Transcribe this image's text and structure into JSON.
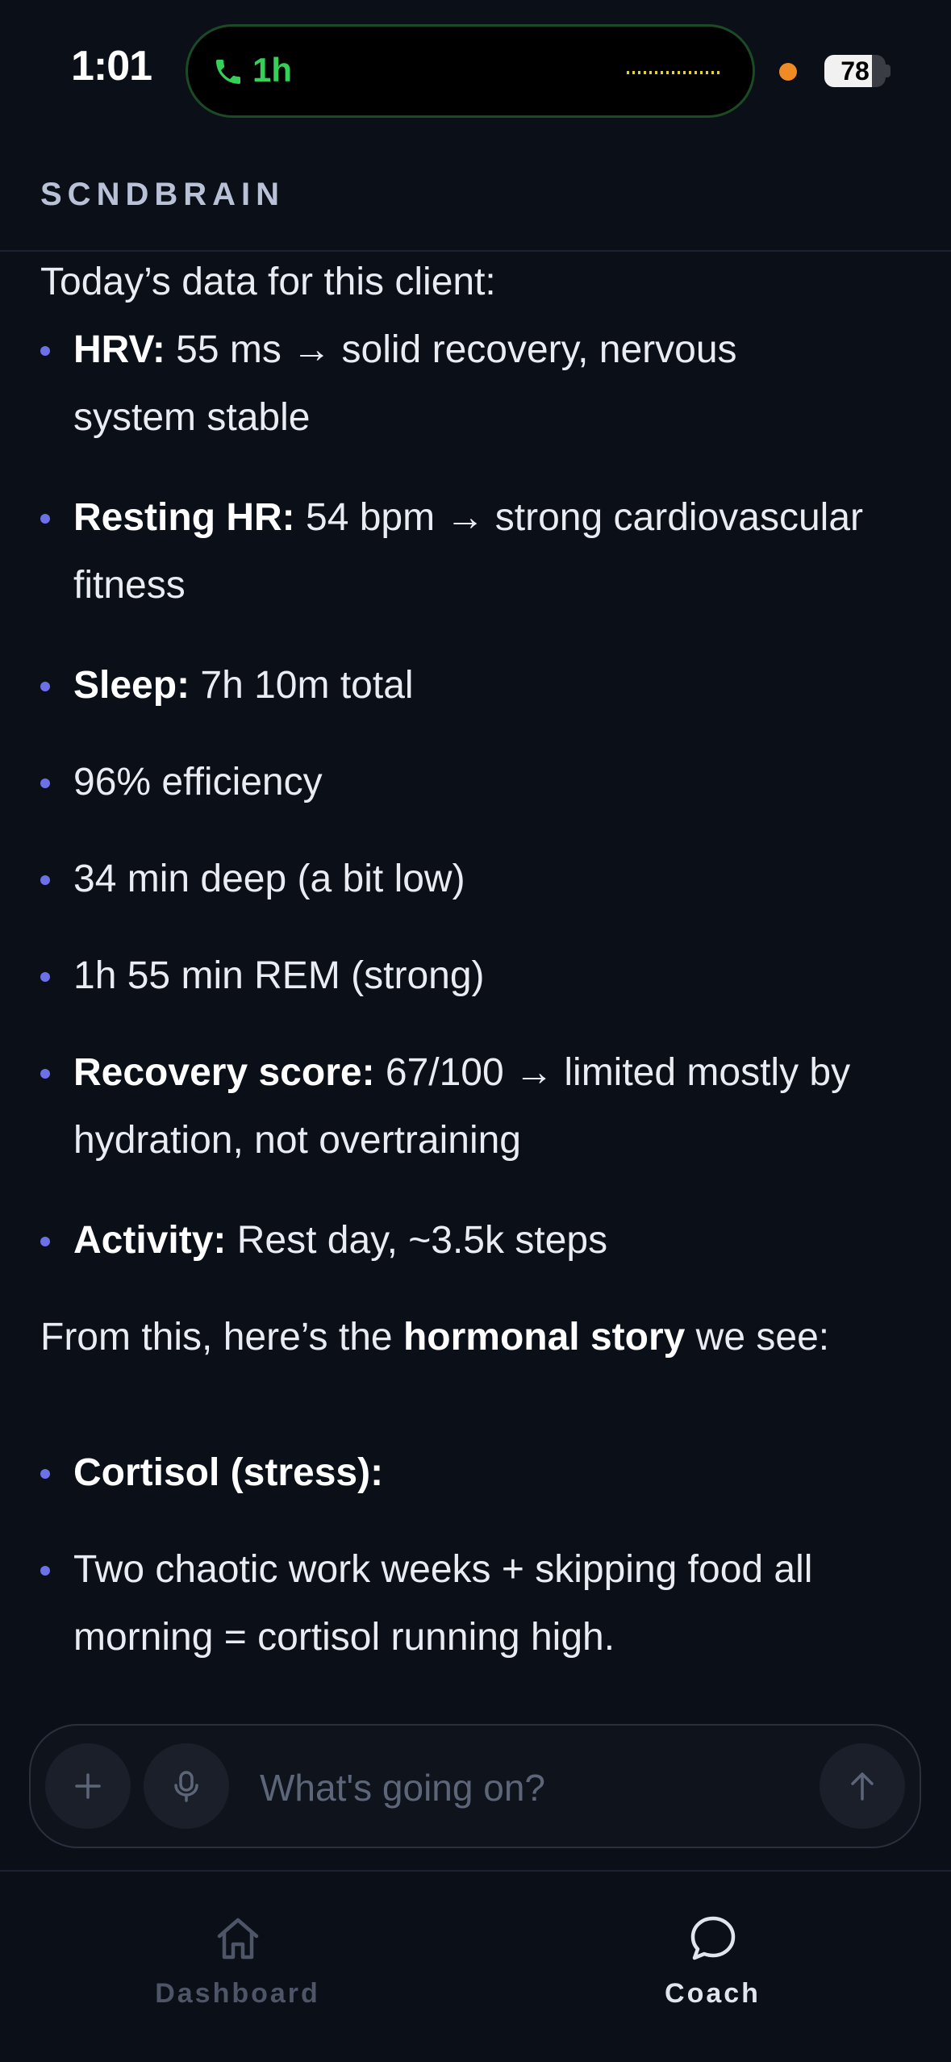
{
  "status_bar": {
    "time": "1:01",
    "call_duration": "1h",
    "battery_percent": 78,
    "battery_label": "78"
  },
  "app": {
    "brand": "SCNDBRAIN"
  },
  "chat": {
    "intro": "Today’s data for this client:",
    "metrics": [
      {
        "label": "HRV:",
        "text": " 55 ms → solid recovery, nervous system stable"
      },
      {
        "label": "Resting HR:",
        "text": " 54 bpm → strong cardiovascular fitness"
      },
      {
        "label": "Sleep:",
        "text": " 7h 10m total"
      },
      {
        "label": "",
        "text": "96% efficiency"
      },
      {
        "label": "",
        "text": "34 min deep (a bit low)"
      },
      {
        "label": "",
        "text": "1h 55 min REM (strong)"
      },
      {
        "label": "Recovery score:",
        "text": " 67/100 → limited mostly by hydration, not overtraining"
      },
      {
        "label": "Activity:",
        "text": " Rest day, ~3.5k steps"
      }
    ],
    "story_prefix": "From this, here’s the ",
    "story_bold": "hormonal story",
    "story_suffix": " we see:",
    "hormones": [
      {
        "label": "Cortisol (stress):",
        "text": ""
      },
      {
        "label": "",
        "text": "Two chaotic work weeks + skipping food all morning = cortisol running high."
      }
    ]
  },
  "composer": {
    "placeholder": "What's going on?"
  },
  "nav": {
    "tabs": [
      {
        "label": "Dashboard",
        "icon": "home-icon",
        "active": false
      },
      {
        "label": "Coach",
        "icon": "chat-bubble-icon",
        "active": true
      }
    ]
  },
  "colors": {
    "background": "#0b0f18",
    "bullet": "#6b72e8",
    "call_green": "#34d058",
    "recording_dot": "#f08a24"
  }
}
